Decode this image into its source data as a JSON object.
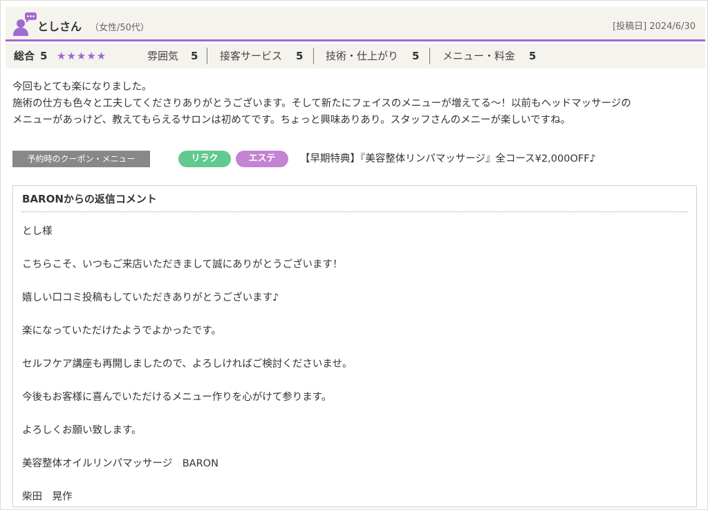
{
  "reviewer": {
    "name": "としさん",
    "meta": "（女性/50代）",
    "post_date": "[投稿日] 2024/6/30"
  },
  "colors": {
    "accent": "#a06ad0",
    "star": "#9a68cf",
    "tag_relax": "#62c990",
    "tag_esthe": "#c483d3",
    "header_bg": "#f5f3ed"
  },
  "ratings": {
    "overall_label": "総合",
    "overall_value": "5",
    "stars": "★★★★★",
    "star_count": 5,
    "categories": [
      {
        "label": "雰囲気",
        "value": "5"
      },
      {
        "label": "接客サービス",
        "value": "5"
      },
      {
        "label": "技術・仕上がり",
        "value": "5"
      },
      {
        "label": "メニュー・料金",
        "value": "5"
      }
    ]
  },
  "review": {
    "lines": [
      "今回もとても楽になりました。",
      "施術の仕方も色々と工夫してくださりありがとうございます。そして新たにフェイスのメニューが増えてる～！以前もヘッドマッサージの",
      "メニューがあっけど、教えてもらえるサロンは初めてです。ちょっと興味ありあり。スタッフさんのメニーが楽しいですね。"
    ]
  },
  "coupon": {
    "label": "予約時のクーポン・メニュー",
    "tags": [
      "リラク",
      "エステ"
    ],
    "name": "【早期特典】『美容整体リンパマッサージ』全コース¥2,000OFF♪"
  },
  "reply": {
    "title": "BARONからの返信コメント",
    "lines": [
      "とし様",
      "こちらこそ、いつもご来店いただきまして誠にありがとうございます！",
      "嬉しい口コミ投稿もしていただきありがとうございます♪",
      "楽になっていただけたようでよかったです。",
      "セルフケア講座も再開しましたので、よろしければご検討くださいませ。",
      "今後もお客様に喜んでいただけるメニュー作りを心がけて参ります。",
      "よろしくお願い致します。",
      "美容整体オイルリンパマッサージ　BARON",
      "柴田　晃作"
    ]
  },
  "icons": {
    "avatar": "user-with-speech-bubble-icon",
    "star": "star-icon"
  }
}
